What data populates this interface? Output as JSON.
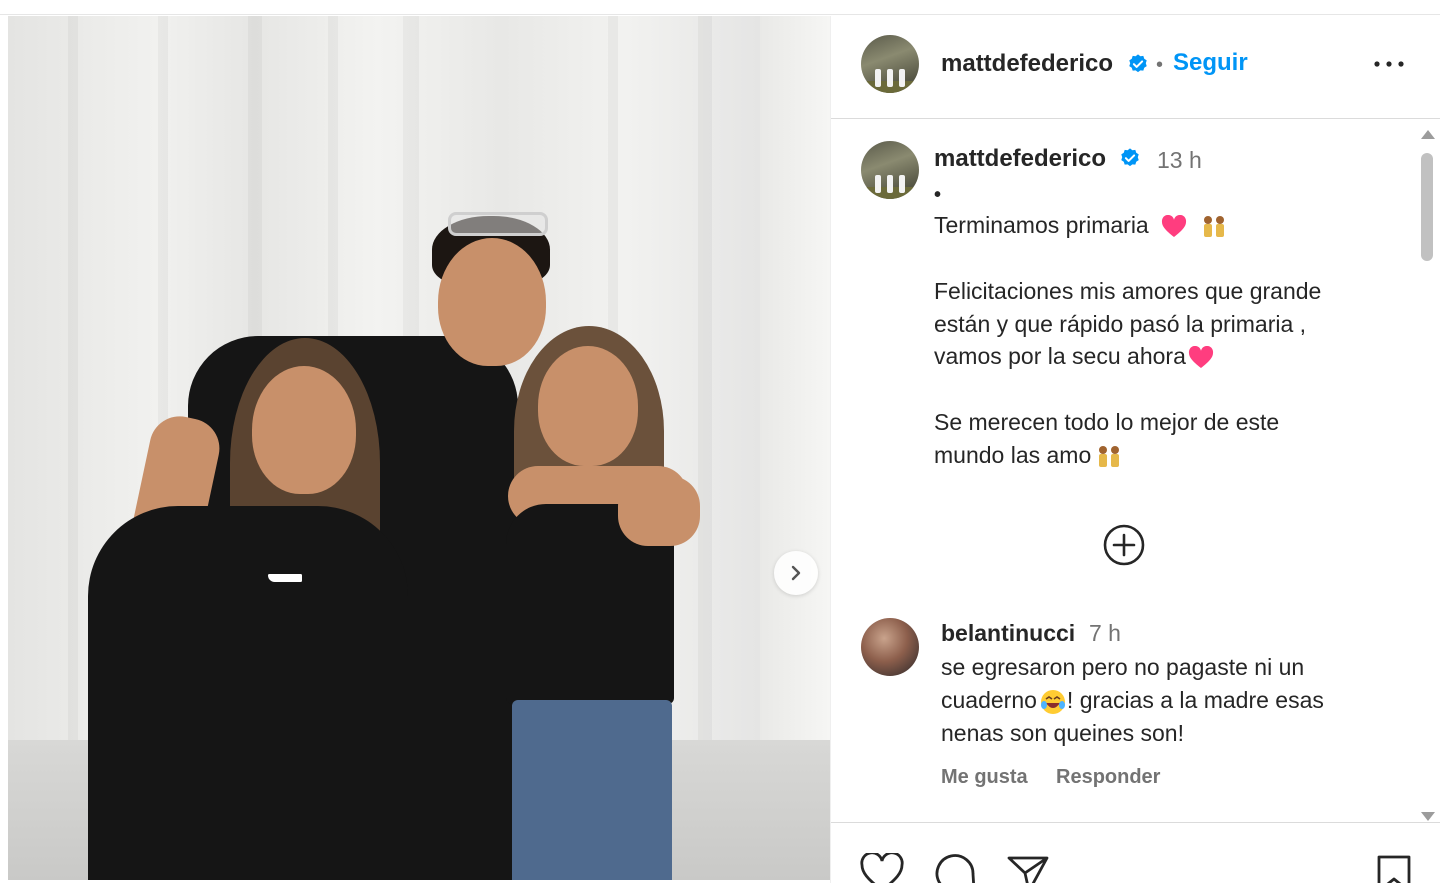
{
  "post": {
    "author": "mattdefederico",
    "follow_label": "Seguir",
    "separator": "•",
    "time": "13 h",
    "caption_bullet": "•",
    "caption_lines": [
      "Terminamos primaria",
      "Felicitaciones mis amores que grande",
      "están y que rápido pasó la primaria ,",
      "vamos por la secu ahora",
      "Se merecen todo lo mejor de este",
      "mundo las amo"
    ]
  },
  "comment": {
    "user": "belantinucci",
    "time": "7 h",
    "lines": [
      "se egresaron pero no pagaste ni un",
      "cuaderno",
      "! gracias a la madre esas",
      "nenas son queines son!"
    ],
    "like_label": "Me gusta",
    "reply_label": "Responder"
  },
  "icons": {
    "verified": "verified-badge-icon",
    "more": "more-options-icon",
    "next": "chevron-right-icon",
    "plus": "plus-circle-icon",
    "like": "heart-icon",
    "comment": "comment-icon",
    "share": "share-icon",
    "save": "bookmark-icon"
  },
  "colors": {
    "link_blue": "#0095f6",
    "verified_blue": "#0095f6",
    "heart_pink": "#ff3d7f",
    "muted_text": "#737373"
  }
}
